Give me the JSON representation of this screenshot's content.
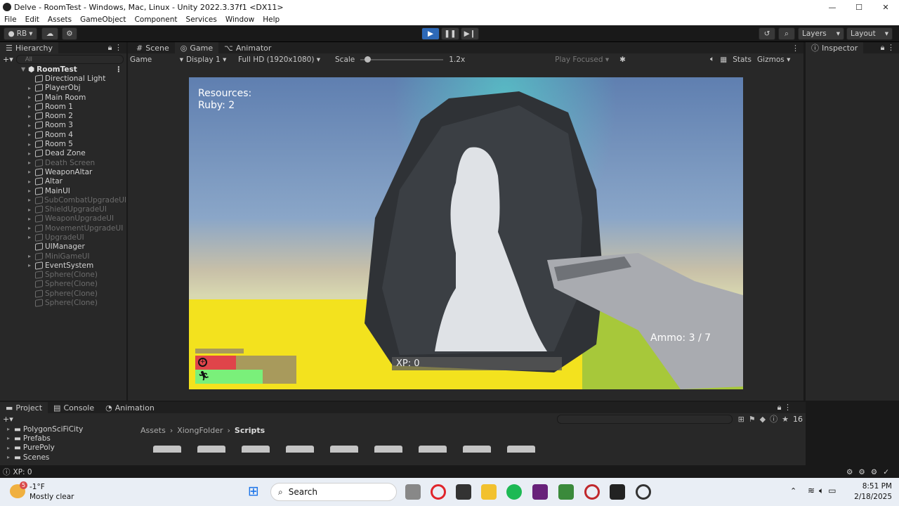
{
  "window": {
    "title": "Delve - RoomTest - Windows, Mac, Linux - Unity 2022.3.37f1 <DX11>"
  },
  "menu": [
    "File",
    "Edit",
    "Assets",
    "GameObject",
    "Component",
    "Services",
    "Window",
    "Help"
  ],
  "toolbar": {
    "account": "RB",
    "layers": "Layers",
    "layout": "Layout"
  },
  "hierarchy": {
    "tab": "Hierarchy",
    "search_placeholder": "All",
    "scene": "RoomTest",
    "items": [
      {
        "label": "Directional Light",
        "dim": false,
        "arrow": false
      },
      {
        "label": "PlayerObj",
        "dim": false,
        "arrow": true
      },
      {
        "label": "Main Room",
        "dim": false,
        "arrow": true
      },
      {
        "label": "Room 1",
        "dim": false,
        "arrow": true
      },
      {
        "label": "Room 2",
        "dim": false,
        "arrow": true
      },
      {
        "label": "Room 3",
        "dim": false,
        "arrow": true
      },
      {
        "label": "Room 4",
        "dim": false,
        "arrow": true
      },
      {
        "label": "Room 5",
        "dim": false,
        "arrow": true
      },
      {
        "label": "Dead Zone",
        "dim": false,
        "arrow": true
      },
      {
        "label": "Death Screen",
        "dim": true,
        "arrow": true
      },
      {
        "label": "WeaponAltar",
        "dim": false,
        "arrow": true
      },
      {
        "label": "Altar",
        "dim": false,
        "arrow": true
      },
      {
        "label": "MainUI",
        "dim": false,
        "arrow": true
      },
      {
        "label": "SubCombatUpgradeUI",
        "dim": true,
        "arrow": true
      },
      {
        "label": "ShieldUpgradeUI",
        "dim": true,
        "arrow": true
      },
      {
        "label": "WeaponUpgradeUI",
        "dim": true,
        "arrow": true
      },
      {
        "label": "MovementUpgradeUI",
        "dim": true,
        "arrow": true
      },
      {
        "label": "UpgradeUI",
        "dim": true,
        "arrow": true
      },
      {
        "label": "UIManager",
        "dim": false,
        "arrow": false
      },
      {
        "label": "MiniGameUI",
        "dim": true,
        "arrow": true
      },
      {
        "label": "EventSystem",
        "dim": false,
        "arrow": true
      },
      {
        "label": "Sphere(Clone)",
        "dim": true,
        "arrow": false
      },
      {
        "label": "Sphere(Clone)",
        "dim": true,
        "arrow": false
      },
      {
        "label": "Sphere(Clone)",
        "dim": true,
        "arrow": false
      },
      {
        "label": "Sphere(Clone)",
        "dim": true,
        "arrow": false
      }
    ]
  },
  "center_tabs": {
    "scene": "Scene",
    "game": "Game",
    "animator": "Animator"
  },
  "gamebar": {
    "mode": "Game",
    "display": "Display 1",
    "resolution": "Full HD (1920x1080)",
    "scale_label": "Scale",
    "scale_value": "1.2x",
    "scale_fraction": 0.05,
    "play_focused": "Play Focused",
    "stats": "Stats",
    "gizmos": "Gizmos"
  },
  "hud": {
    "resources_title": "Resources:",
    "ruby": "Ruby: 2",
    "ammo": "Ammo: 3 / 7",
    "xp": "XP: 0",
    "health_fraction": 0.4,
    "stamina_fraction": 0.67
  },
  "inspector": {
    "tab": "Inspector"
  },
  "bottom": {
    "tabs": [
      "Project",
      "Console",
      "Animation"
    ],
    "folders": [
      "PolygonSciFiCity",
      "Prefabs",
      "PurePoly",
      "Scenes"
    ],
    "breadcrumb": [
      "Assets",
      "XiongFolder",
      "Scripts"
    ],
    "hidden_count": "16"
  },
  "status": {
    "text": "XP: 0"
  },
  "taskbar": {
    "temp": "-1°F",
    "weather": "Mostly clear",
    "weather_badge": "5",
    "search": "Search",
    "time": "8:51 PM",
    "date": "2/18/2025"
  },
  "colors": {
    "play": "#2d69b8",
    "health": "#e0444a",
    "stamina": "#7af07a",
    "bar_bg": "#a89a5c"
  }
}
